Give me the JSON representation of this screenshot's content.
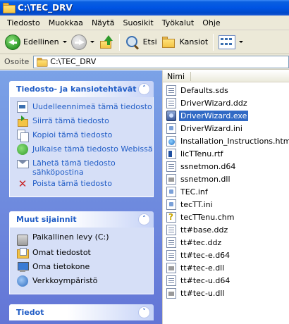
{
  "window": {
    "title": "C:\\TEC_DRV"
  },
  "menu": [
    "Tiedosto",
    "Muokkaa",
    "Näytä",
    "Suosikit",
    "Työkalut",
    "Ohje"
  ],
  "toolbar": {
    "back_label": "Edellinen",
    "search_label": "Etsi",
    "folders_label": "Kansiot"
  },
  "address": {
    "label": "Osoite",
    "value": "C:\\TEC_DRV"
  },
  "tasks_panel": {
    "title": "Tiedosto- ja kansiotehtävät",
    "items": [
      {
        "label": "Uudelleennimeä tämä tiedosto",
        "icon": "rename-icon"
      },
      {
        "label": "Siirrä tämä tiedosto",
        "icon": "move-icon"
      },
      {
        "label": "Kopioi tämä tiedosto",
        "icon": "copy-icon"
      },
      {
        "label": "Julkaise tämä tiedosto Webissä",
        "icon": "publish-web-icon"
      },
      {
        "label": "Lähetä tämä tiedosto sähköpostina",
        "icon": "email-icon"
      },
      {
        "label": "Poista tämä tiedosto",
        "icon": "delete-icon"
      }
    ]
  },
  "places_panel": {
    "title": "Muut sijainnit",
    "items": [
      {
        "label": "Paikallinen levy (C:)",
        "icon": "drive-icon"
      },
      {
        "label": "Omat tiedostot",
        "icon": "my-documents-icon"
      },
      {
        "label": "Oma tietokone",
        "icon": "my-computer-icon"
      },
      {
        "label": "Verkkoympäristö",
        "icon": "network-icon"
      }
    ]
  },
  "details_panel": {
    "title": "Tiedot"
  },
  "filelist": {
    "column_name": "Nimi",
    "selected_index": 2,
    "files": [
      {
        "name": "Defaults.sds",
        "type": "doc"
      },
      {
        "name": "DriverWizard.ddz",
        "type": "doc"
      },
      {
        "name": "DriverWizard.exe",
        "type": "exe"
      },
      {
        "name": "DriverWizard.ini",
        "type": "ini"
      },
      {
        "name": "Installation_Instructions.html",
        "type": "html"
      },
      {
        "name": "licTTenu.rtf",
        "type": "rtf"
      },
      {
        "name": "ssnetmon.d64",
        "type": "doc"
      },
      {
        "name": "ssnetmon.dll",
        "type": "sys"
      },
      {
        "name": "TEC.inf",
        "type": "ini"
      },
      {
        "name": "tecTT.ini",
        "type": "ini"
      },
      {
        "name": "tecTTenu.chm",
        "type": "chm"
      },
      {
        "name": "tt#base.ddz",
        "type": "doc"
      },
      {
        "name": "tt#tec.ddz",
        "type": "doc"
      },
      {
        "name": "tt#tec-e.d64",
        "type": "doc"
      },
      {
        "name": "tt#tec-e.dll",
        "type": "sys"
      },
      {
        "name": "tt#tec-u.d64",
        "type": "doc"
      },
      {
        "name": "tt#tec-u.dll",
        "type": "sys"
      }
    ]
  }
}
